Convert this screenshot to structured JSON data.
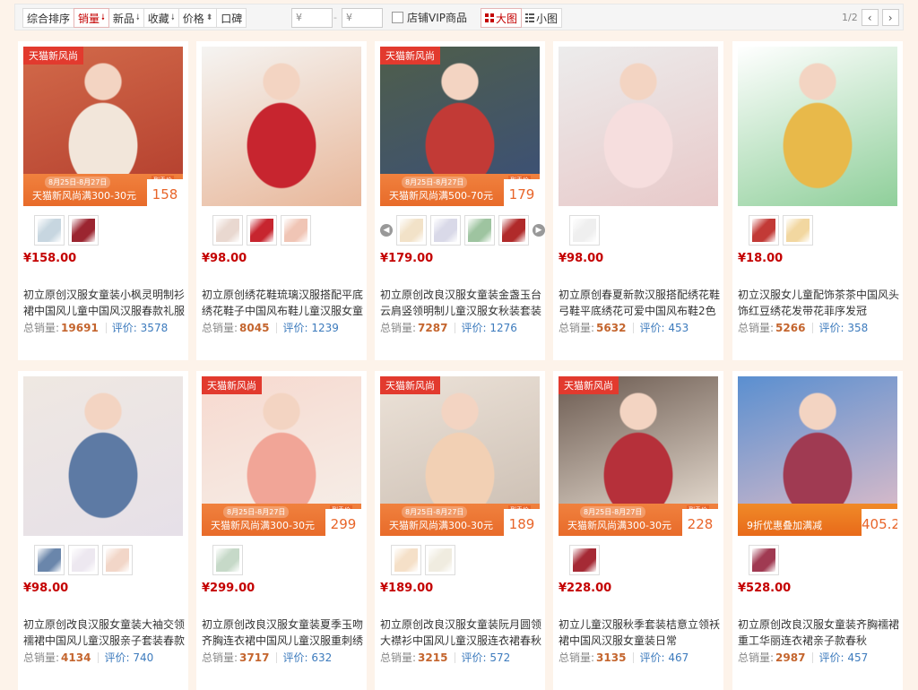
{
  "filter": {
    "sort_options": [
      {
        "label": "综合排序",
        "arrow": ""
      },
      {
        "label": "销量",
        "arrow": "🠗"
      },
      {
        "label": "新品",
        "arrow": "🠗"
      },
      {
        "label": "收藏",
        "arrow": "🠗"
      },
      {
        "label": "价格",
        "arrow": "⬍"
      },
      {
        "label": "口碑",
        "arrow": ""
      }
    ],
    "active_sort": "销量",
    "price_min_placeholder": "¥",
    "price_max_placeholder": "¥",
    "price_dash": "-",
    "vip_label": "店铺VIP商品",
    "view_large": "大图",
    "view_small": "小图",
    "page_indicator": "1/2",
    "prev": "‹",
    "next": "›"
  },
  "labels": {
    "sales": "总销量:",
    "reviews": "评价:"
  },
  "products": [
    {
      "price": "¥158.00",
      "title": "初立原创汉服女童装小枫灵明制衫裙中国风儿童中国风汉服春款礼服",
      "sales": "19691",
      "reviews": "3578",
      "badge": "天猫新风尚",
      "promo_date": "8月25日-8月27日",
      "promo_text": "天猫新风尚满300-30元",
      "promo_price": "158",
      "promo_label": "到手价",
      "img": [
        "#d26a4a",
        "#f2e6da",
        "#b23c2c"
      ],
      "swatches": [
        "#c7d6e0",
        "#9b2530"
      ]
    },
    {
      "price": "¥98.00",
      "title": "初立原创绣花鞋琉璃汉服搭配平底绣花鞋子中国风布鞋儿童汉服女童",
      "sales": "8045",
      "reviews": "1239",
      "img": [
        "#f5f4f2",
        "#c7252f",
        "#e8b79a"
      ],
      "swatches": [
        "#e9d8d0",
        "#c7252f",
        "#f0c5b5"
      ]
    },
    {
      "price": "¥179.00",
      "title": "初立原创改良汉服女童装金盏玉台云肩竖领明制儿童汉服女秋装套装",
      "sales": "7287",
      "reviews": "1276",
      "badge": "天猫新风尚",
      "promo_date": "8月25日-8月27日",
      "promo_text": "天猫新风尚满500-70元",
      "promo_price": "179",
      "promo_label": "到手价",
      "img": [
        "#4f5e4a",
        "#c23a36",
        "#3a4f7a"
      ],
      "swatches": [
        "#f2e2c8",
        "#d9d9e8",
        "#9ec4a0",
        "#b02a2a"
      ],
      "arrows": true
    },
    {
      "price": "¥98.00",
      "title": "初立原创春夏新款汉服搭配绣花鞋弓鞋平底绣花可爱中国风布鞋2色",
      "sales": "5632",
      "reviews": "453",
      "img": [
        "#ececec",
        "#f6dede",
        "#e8c9c9"
      ],
      "swatches": [
        "#efefef"
      ]
    },
    {
      "price": "¥18.00",
      "title": "初立汉服女儿童配饰茶茶中国风头饰红豆绣花发带花菲序发冠",
      "sales": "5266",
      "reviews": "358",
      "img": [
        "#ffffff",
        "#e8b94a",
        "#8fcf9a"
      ],
      "swatches": [
        "#c23a36",
        "#f2d7a0"
      ]
    },
    {
      "price": "¥98.00",
      "title": "初立原创改良汉服女童装大袖交领襦裙中国风儿童汉服亲子套装春款",
      "sales": "4134",
      "reviews": "740",
      "img": [
        "#efe8e2",
        "#5d7aa4",
        "#e6e0e8"
      ],
      "swatches": [
        "#6a86ab",
        "#ede8f0",
        "#f2d6c8"
      ]
    },
    {
      "price": "¥299.00",
      "title": "初立原创改良汉服女童装夏季玉吻齐胸连衣裙中国风儿童汉服重刺绣",
      "sales": "3717",
      "reviews": "632",
      "badge": "天猫新风尚",
      "promo_date": "8月25日-8月27日",
      "promo_text": "天猫新风尚满300-30元",
      "promo_price": "299",
      "promo_label": "到手价",
      "img": [
        "#f7d9cf",
        "#f1a597",
        "#f5f0ea"
      ],
      "swatches": [
        "#c6d9c8"
      ]
    },
    {
      "price": "¥189.00",
      "title": "初立原创改良汉服女童装阮月圆领大襟衫中国风儿童汉服连衣裙春秋",
      "sales": "3215",
      "reviews": "572",
      "badge": "天猫新风尚",
      "promo_date": "8月25日-8月27日",
      "promo_text": "天猫新风尚满300-30元",
      "promo_price": "189",
      "promo_label": "到手价",
      "img": [
        "#ece2d8",
        "#f2d0b4",
        "#c9bcb0"
      ],
      "swatches": [
        "#f5e0c8",
        "#f0ece0"
      ]
    },
    {
      "price": "¥228.00",
      "title": "初立儿童汉服秋季套装桔意立领袄裙中国风汉服女童装日常",
      "sales": "3135",
      "reviews": "467",
      "badge": "天猫新风尚",
      "promo_date": "8月25日-8月27日",
      "promo_text": "天猫新风尚满300-30元",
      "promo_price": "228",
      "promo_label": "到手价",
      "img": [
        "#6b5a50",
        "#b6303a",
        "#f3e9dd"
      ],
      "swatches": [
        "#a52a35"
      ]
    },
    {
      "price": "¥528.00",
      "title": "初立原创改良汉服女童装齐胸襦裙重工华丽连衣裙亲子款春秋",
      "sales": "2987",
      "reviews": "457",
      "promo_price": "405.2",
      "promo_text": "9折优惠叠加满减",
      "img": [
        "#5a8fd0",
        "#a03a52",
        "#e8c0c8"
      ],
      "swatches": [
        "#a03a52"
      ],
      "banner_style": "orange"
    }
  ]
}
